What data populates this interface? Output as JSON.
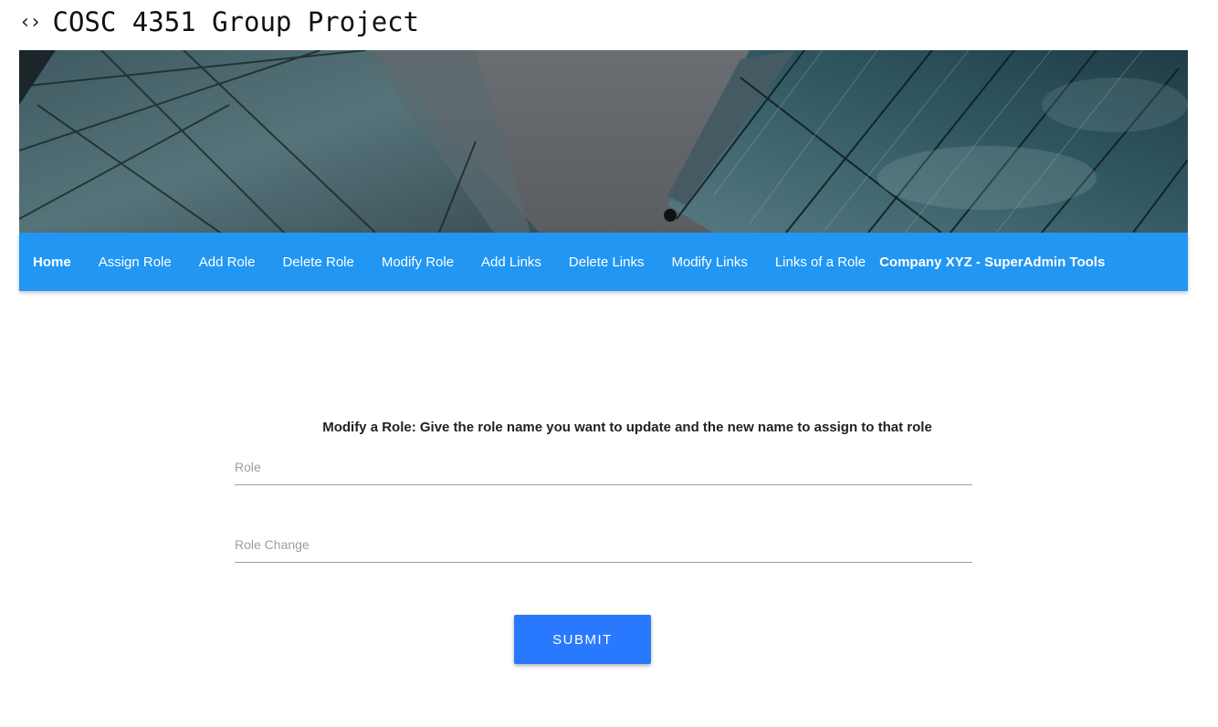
{
  "app": {
    "icon": "code-icon",
    "title": "COSC 4351 Group Project"
  },
  "hero": {
    "image": "glass-skyscrapers-photo"
  },
  "nav": {
    "items": [
      {
        "label": "Home",
        "bold": true
      },
      {
        "label": "Assign Role"
      },
      {
        "label": "Add Role"
      },
      {
        "label": "Delete Role"
      },
      {
        "label": "Modify Role"
      },
      {
        "label": "Add Links"
      },
      {
        "label": "Delete Links"
      },
      {
        "label": "Modify Links"
      },
      {
        "label": "Links of a Role"
      }
    ],
    "brand": "Company XYZ - SuperAdmin Tools"
  },
  "form": {
    "heading": "Modify a Role: Give the role name you want to update and the new name to assign to that role",
    "role_placeholder": "Role",
    "role_value": "",
    "role_change_placeholder": "Role Change",
    "role_change_value": "",
    "submit_label": "SUBMIT"
  },
  "colors": {
    "nav_bg": "#2196f3",
    "submit_bg": "#2979ff"
  }
}
